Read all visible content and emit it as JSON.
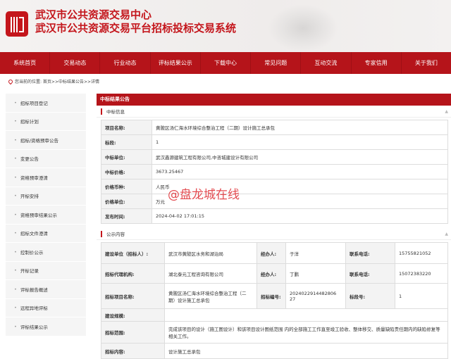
{
  "header": {
    "title1": "武汉市公共资源交易中心",
    "title2": "武汉市公共资源交易平台招标投标交易系统"
  },
  "nav": [
    "系统首页",
    "交易动态",
    "行业动态",
    "评标结果公示",
    "下载中心",
    "常见问题",
    "互动交流",
    "专家信用",
    "关于我们"
  ],
  "breadcrumb": "您当前的位置: 首页>>中标结果公告>>详情",
  "sidebar": [
    "招标项目登记",
    "招标计划",
    "招标/资格预审公告",
    "变更公告",
    "资格预审澄清",
    "开标安排",
    "资格预审结果公示",
    "招标文件澄清",
    "控制价公示",
    "开标记录",
    "评标报告概述",
    "远程异地评标",
    "评标结果公示"
  ],
  "main": {
    "title": "中标结果公告",
    "section1": "中标信息",
    "section2": "公示内容",
    "info": [
      [
        "项目名称:",
        "黄陂区汤仁海水环境综合整治工程（二期）设计施工总承包"
      ],
      [
        "标段:",
        "1"
      ],
      [
        "中标单位:",
        "武汉鑫源建筑工程有限公司,中咨城建设计有限公司"
      ],
      [
        "中标价格:",
        "3673.25467"
      ],
      [
        "价格币种:",
        "人民币"
      ],
      [
        "价格单位:",
        "万元"
      ],
      [
        "发布时间:",
        "2024-04-02 17:01:15"
      ]
    ],
    "pub": {
      "r1": [
        "建设单位（招标人）:",
        "武汉市黄陂区水务和湖泊局",
        "经办人:",
        "于洋",
        "联系电话:",
        "15755821052"
      ],
      "r2": [
        "招标代理机构:",
        "湖北泰元工程咨询有限公司",
        "经办人:",
        "丁鹏",
        "联系电话:",
        "15072383220"
      ],
      "r3": [
        "招标项目名称:",
        "黄陂区汤仁海水环境综合整治工程（二期）设计施工总承包",
        "招标编号:",
        "2024022914482806​27",
        "标段号:",
        "1"
      ],
      "r4": [
        "建设规模:",
        ""
      ],
      "r5": [
        "招标范围:",
        "完成该项目的设计（施工图设计）和该项目设计图纸范围 内的全部施工工作直至竣工验收、整体移交、质量缺陷责任期内的缺陷修复等相关工作。"
      ],
      "r6": [
        "招标内容:",
        "设计施工总承包"
      ]
    }
  },
  "watermark": "@盘龙城在线"
}
